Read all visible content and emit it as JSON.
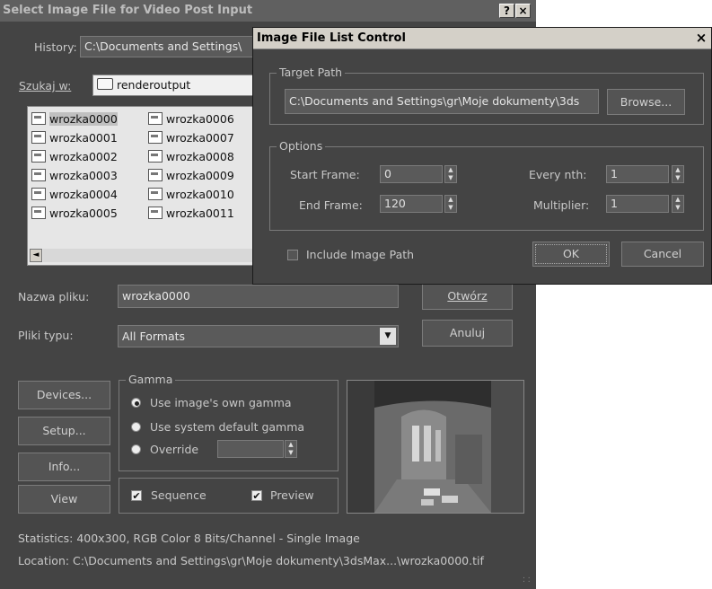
{
  "main_dialog": {
    "title": "Select Image File for Video Post Input",
    "title_buttons": [
      "?",
      "×"
    ],
    "history_label": "History:",
    "history_value": "C:\\Documents and Settings\\",
    "lookin_label": "Szukaj w:",
    "lookin_value": "renderoutput",
    "files_col1": [
      "wrozka0000",
      "wrozka0001",
      "wrozka0002",
      "wrozka0003",
      "wrozka0004",
      "wrozka0005"
    ],
    "files_col2": [
      "wrozka0006",
      "wrozka0007",
      "wrozka0008",
      "wrozka0009",
      "wrozka0010",
      "wrozka0011"
    ],
    "scroll_left": "◄",
    "filename_label": "Nazwa pliku:",
    "filename_value": "wrozka0000",
    "open_button": "Otwórz",
    "filetype_label": "Pliki typu:",
    "filetype_value": "All Formats",
    "dropdown_arrow": "▼",
    "cancel_button": "Anuluj",
    "devices_button": "Devices...",
    "setup_button": "Setup...",
    "info_button": "Info...",
    "view_button": "View",
    "gamma_title": "Gamma",
    "gamma_options": [
      "Use image's own gamma",
      "Use system default gamma",
      "Override"
    ],
    "gamma_selected": 0,
    "sequence_label": "Sequence",
    "sequence_checked": true,
    "preview_label": "Preview",
    "preview_checked": true,
    "statistics": "Statistics:  400x300, RGB Color 8 Bits/Channel - Single Image",
    "location": "Location:  C:\\Documents and Settings\\gr\\Moje dokumenty\\3dsMax...\\wrozka0000.tif"
  },
  "overlay_dialog": {
    "title": "Image File List Control",
    "close_button": "×",
    "target_path_title": "Target Path",
    "target_path_value": "C:\\Documents and Settings\\gr\\Moje dokumenty\\3ds",
    "browse_button": "Browse...",
    "options_title": "Options",
    "start_frame_label": "Start Frame:",
    "start_frame_value": "0",
    "end_frame_label": "End Frame:",
    "end_frame_value": "120",
    "every_nth_label": "Every nth:",
    "every_nth_value": "1",
    "multiplier_label": "Multiplier:",
    "multiplier_value": "1",
    "include_path_label": "Include Image Path",
    "include_path_checked": false,
    "ok_button": "OK",
    "cancel_button": "Cancel"
  },
  "colors": {
    "dialog_bg": "#444444",
    "field_bg": "#5a5a5a",
    "title_bg": "#606060",
    "list_bg": "#e6e6e6"
  }
}
